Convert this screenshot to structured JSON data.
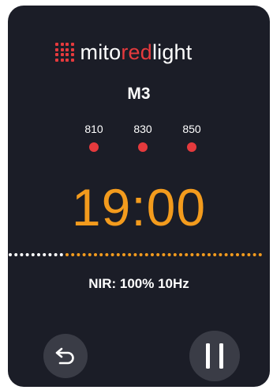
{
  "brand": {
    "name_part1": "mito",
    "name_part2": "red",
    "name_part3": "light",
    "accent_color": "#e53a3d"
  },
  "program": "M3",
  "wavelengths": [
    {
      "label": "810",
      "status_color": "#e53a3d"
    },
    {
      "label": "830",
      "status_color": "#e53a3d"
    },
    {
      "label": "850",
      "status_color": "#e53a3d"
    }
  ],
  "timer": {
    "value": "19:00",
    "color": "#f39b1d"
  },
  "progress": {
    "elapsed_fraction": 0.22,
    "elapsed_color": "#ffffff",
    "remaining_color": "#f39b1d"
  },
  "mode": "NIR: 100% 10Hz",
  "controls": {
    "back_icon": "back-arrow-icon",
    "pause_icon": "pause-icon"
  }
}
